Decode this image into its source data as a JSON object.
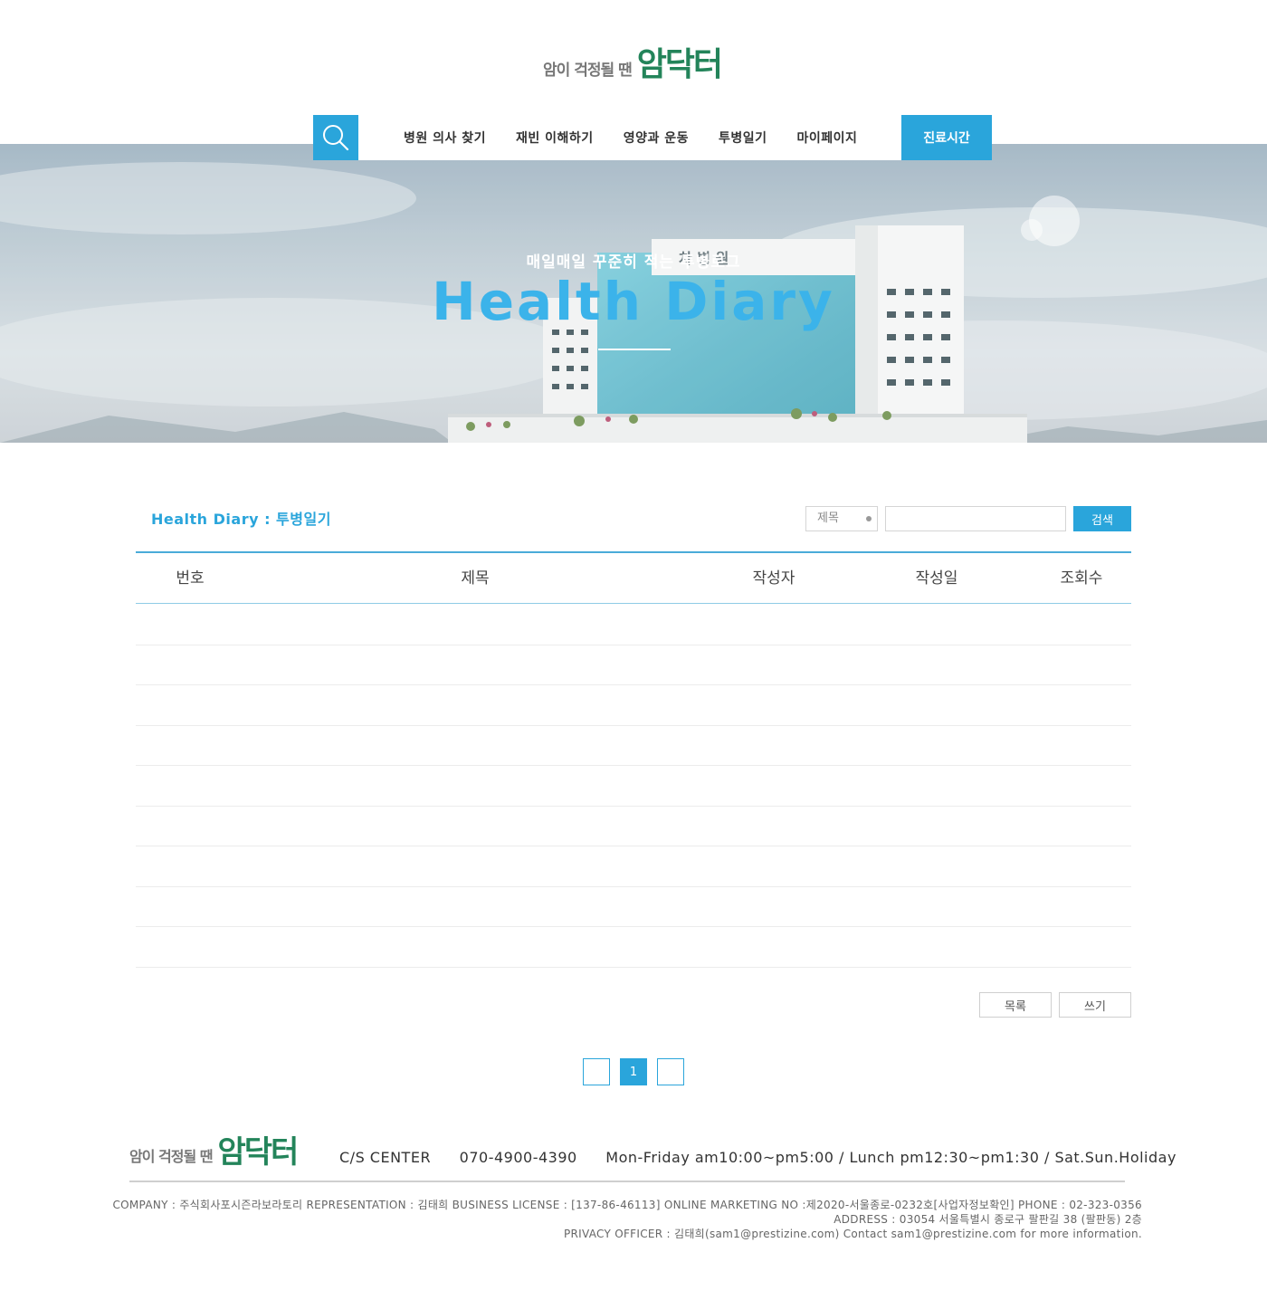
{
  "header": {
    "logo_small": "암이 걱정될 땐",
    "logo_big": "암닥터"
  },
  "nav": {
    "items": [
      {
        "label": "병원 의사 찾기"
      },
      {
        "label": "재빈 이해하기"
      },
      {
        "label": "영양과 운동"
      },
      {
        "label": "투병일기"
      },
      {
        "label": "마이페이지"
      }
    ],
    "hours_label": "진료시간"
  },
  "hero": {
    "subtitle": "매일매일 꾸준히 적는 투병로그",
    "title": "Health Diary"
  },
  "board": {
    "title": "Health Diary : 투병일기",
    "search": {
      "select_value": "제목",
      "input_value": "",
      "button_label": "검색"
    },
    "columns": [
      "번호",
      "제목",
      "작성자",
      "작성일",
      "조회수"
    ],
    "buttons": {
      "list": "목록",
      "write": "쓰기"
    },
    "pagination": {
      "prev": "",
      "current": "1",
      "next": ""
    }
  },
  "footer": {
    "logo_small": "암이 걱정될 땐",
    "logo_big": "암닥터",
    "cs_label": "C/S CENTER",
    "phone": "070-4900-4390",
    "hours": "Mon-Friday am10:00~pm5:00 / Lunch pm12:30~pm1:30 / Sat.Sun.Holiday",
    "info_line1": "COMPANY : 주식회사포시즌라보라토리 REPRESENTATION : 김태희 BUSINESS LICENSE : [137-86-46113] ONLINE MARKETING NO :제2020-서울종로-0232호[사업자정보확인] PHONE : 02-323-0356",
    "info_line2": "ADDRESS : 03054 서울특별시 종로구 팔판길 38 (팔판동) 2층",
    "info_line3": "PRIVACY OFFICER : 김태희(sam1@prestizine.com) Contact sam1@prestizine.com for more information."
  },
  "colors": {
    "accent": "#2aa5db",
    "brand_green": "#23845a",
    "hero_title": "#3bb3ea"
  },
  "icons": {
    "search": "search-icon"
  }
}
